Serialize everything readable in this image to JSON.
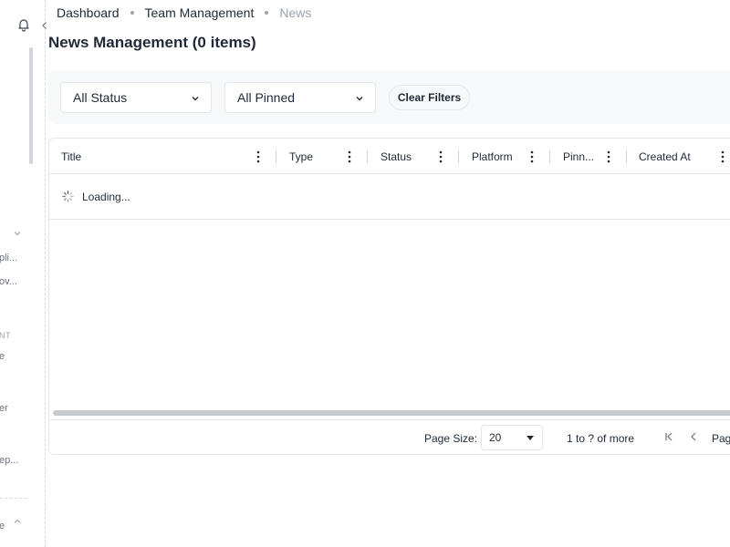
{
  "breadcrumb": {
    "items": [
      "Dashboard",
      "Team Management",
      "News"
    ]
  },
  "page": {
    "title": "News Management (0 items)"
  },
  "sidebar": {
    "truncated_labels": [
      "pli...",
      "ov...",
      "NT",
      "e",
      "er",
      "ep...",
      "e"
    ]
  },
  "filters": {
    "status_value": "All Status",
    "pinned_value": "All Pinned",
    "clear_label": "Clear Filters"
  },
  "grid": {
    "columns": [
      "Title",
      "Type",
      "Status",
      "Platform",
      "Pinn...",
      "Created At"
    ],
    "loading_text": "Loading..."
  },
  "pager": {
    "page_size_label": "Page Size:",
    "page_size_value": "20",
    "range_text": "1 to ? of more",
    "page_label_partial": "Pag"
  },
  "icons": {
    "bell": "bell-icon",
    "collapse": "chevron-left-icon",
    "spinner": "spinner-icon",
    "first_page": "first-page-icon",
    "prev_page": "chevron-left-icon"
  }
}
